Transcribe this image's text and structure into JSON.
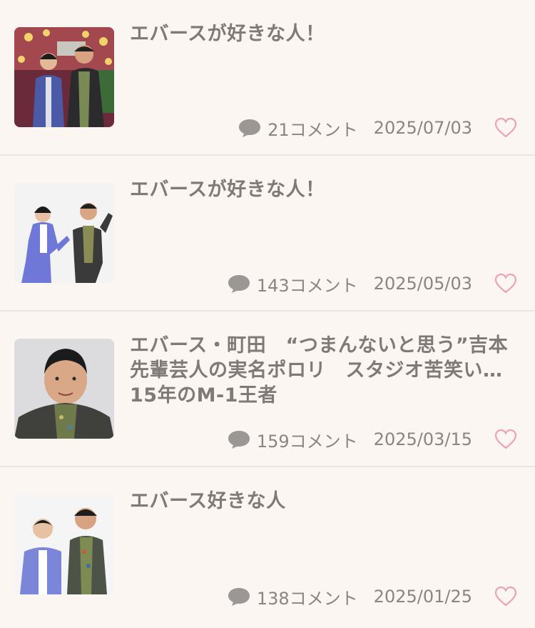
{
  "colors": {
    "background": "#fbf6f2",
    "title_text": "#7f7a77",
    "meta_text": "#8a8583",
    "heart": "#e9a3b5",
    "comment_icon": "#9b9795",
    "divider": "#ece6e1"
  },
  "icons": {
    "comment": "speech-bubble-icon",
    "favorite": "heart-outline-icon"
  },
  "posts": [
    {
      "thumbnail": "two-comedians-on-stage-photo",
      "title": "エバースが好きな人！",
      "comment_count": "21コメント",
      "date": "2025/07/03"
    },
    {
      "thumbnail": "two-comedians-posing-photo",
      "title": "エバースが好きな人！",
      "comment_count": "143コメント",
      "date": "2025/05/03"
    },
    {
      "thumbnail": "man-portrait-photo",
      "title": "エバース・町田　“つまんないと思う”吉本先輩芸人の実名ポロリ　スタジオ苦笑い…15年のM-1王者",
      "comment_count": "159コメント",
      "date": "2025/03/15"
    },
    {
      "thumbnail": "two-comedians-standing-photo",
      "title": "エバース好きな人",
      "comment_count": "138コメント",
      "date": "2025/01/25"
    }
  ]
}
